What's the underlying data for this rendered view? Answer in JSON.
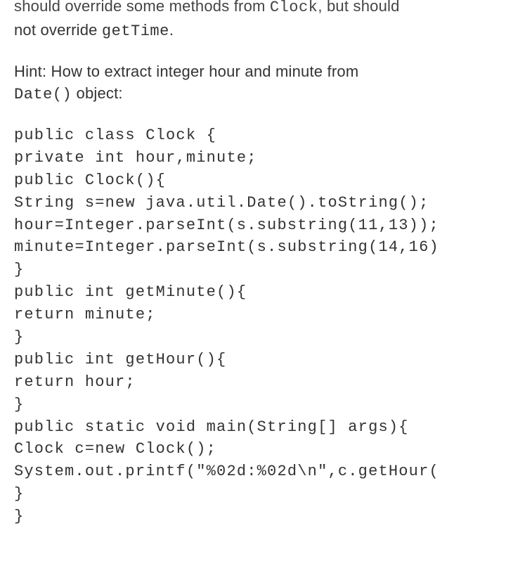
{
  "intro": {
    "line1_pre": "should override some methods from ",
    "line1_code": "Clock",
    "line1_post": ", but should",
    "line2_pre": "not override ",
    "line2_code": "getTime",
    "line2_post": "."
  },
  "hint": {
    "line1": "Hint: How to extract integer hour and minute from",
    "line2_code": "Date()",
    "line2_post": " object:"
  },
  "code": {
    "l1": "public class Clock {",
    "l2": "private int hour,minute;",
    "l3": "public Clock(){",
    "l4": "String s=new java.util.Date().toString();",
    "l5": "hour=Integer.parseInt(s.substring(11,13));",
    "l6": "minute=Integer.parseInt(s.substring(14,16)",
    "l7": "}",
    "l8": "public int getMinute(){",
    "l9": "return minute;",
    "l10": "}",
    "l11": "public int getHour(){",
    "l12": "return hour;",
    "l13": "}",
    "l14": "public static void main(String[] args){",
    "l15": "Clock c=new Clock();",
    "l16": "System.out.printf(\"%02d:%02d\\n\",c.getHour(",
    "l17": "}",
    "l18": "}"
  }
}
